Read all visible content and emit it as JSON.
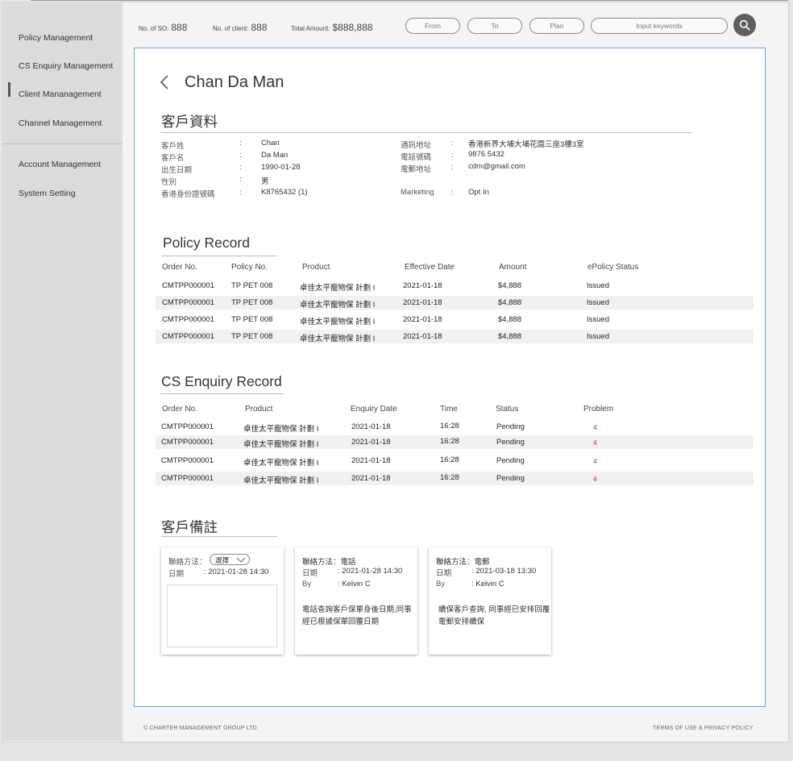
{
  "sidebar": {
    "items": [
      {
        "label": "Policy Management"
      },
      {
        "label": "CS Enquiry Management"
      },
      {
        "label": "Client Mananagement"
      },
      {
        "label": "Channel Management"
      },
      {
        "label": "Account Management"
      },
      {
        "label": "System Setting"
      }
    ],
    "active_index": 2
  },
  "topbar": {
    "so_label": "No. of SO:",
    "so_value": "888",
    "client_label": "No. of client:",
    "client_value": "888",
    "amount_label": "Total Amount:",
    "amount_value": "$888,888",
    "from_placeholder": "From",
    "to_placeholder": "To",
    "plan_placeholder": "Plan",
    "keyword_placeholder": "Input keywords"
  },
  "client": {
    "name": "Chan Da Man",
    "section_title": "客戶資料",
    "fields_left": [
      {
        "label": "客戶姓",
        "value": "Chan"
      },
      {
        "label": "客戶名",
        "value": "Da Man"
      },
      {
        "label": "出生日期",
        "value": "1990-01-28"
      },
      {
        "label": "性別",
        "value": "男"
      },
      {
        "label": "香港身份證號碼",
        "value": "K8765432 (1)"
      }
    ],
    "fields_right": [
      {
        "label": "通訊地址",
        "value": "香港新界大埔大埔花園三座3樓3室"
      },
      {
        "label": "電話號碼",
        "value": "9876 5432"
      },
      {
        "label": "電郵地址",
        "value": "cdm@gmail.com"
      },
      {
        "label": "Marketing",
        "value": "Opt In"
      }
    ],
    "colon": ":"
  },
  "policy": {
    "title": "Policy Record",
    "headers": [
      "Order No.",
      "Policy No.",
      "Product",
      "Effective Date",
      "Amount",
      "ePolicy Status"
    ],
    "rows": [
      [
        "CMTPP000001",
        "TP PET 008",
        "卓佳太平寵物保 計劃 I",
        "2021-01-18",
        "$4,888",
        "Issued"
      ],
      [
        "CMTPP000001",
        "TP PET 008",
        "卓佳太平寵物保 計劃 I",
        "2021-01-18",
        "$4,888",
        "Issued"
      ],
      [
        "CMTPP000001",
        "TP PET 008",
        "卓佳太平寵物保 計劃 I",
        "2021-01-18",
        "$4,888",
        "Issued"
      ],
      [
        "CMTPP000001",
        "TP PET 008",
        "卓佳太平寵物保 計劃 I",
        "2021-01-18",
        "$4,888",
        "Issued"
      ]
    ]
  },
  "enquiry": {
    "title": "CS Enquiry Record",
    "headers": [
      "Order No.",
      "Product",
      "Enquiry Date",
      "Time",
      "Status",
      "Problem"
    ],
    "rows": [
      [
        "CMTPP000001",
        "卓佳太平寵物保 計劃 I",
        "2021-01-18",
        "16:28",
        "Pending",
        "4"
      ],
      [
        "CMTPP000001",
        "卓佳太平寵物保 計劃 I",
        "2021-01-18",
        "16:28",
        "Pending",
        "4"
      ],
      [
        "CMTPP000001",
        "卓佳太平寵物保 計劃 I",
        "2021-01-18",
        "16:28",
        "Pending",
        "4"
      ],
      [
        "CMTPP000001",
        "卓佳太平寵物保 計劃 I",
        "2021-01-18",
        "16:28",
        "Pending",
        "4"
      ]
    ]
  },
  "remarks": {
    "title": "客戶備註",
    "new_card": {
      "contact_label": "聯絡方法：",
      "select_value": "選擇",
      "date_label": "日期",
      "date_value": ": 2021-01-28 14:30"
    },
    "cards": [
      {
        "contact": "聯絡方法：電話",
        "date_label": "日期",
        "date_value": ": 2021-01-28 14:30",
        "by_label": "By",
        "by_value": ":   Kelvin C",
        "note": "電話查詢客戶保單身後日期,同事經已根據保單回覆日期"
      },
      {
        "contact": "聯絡方法：電郵",
        "date_label": "日期",
        "date_value": ": 2021-03-18 13:30",
        "by_label": "By",
        "by_value": ":   Kelvin C",
        "note": "續保客戶查詢, 同事經已安排回覆電郵安排續保"
      }
    ]
  },
  "footer": {
    "copyright": "© CHARTER MANAGEMENT GROUP LTD",
    "terms": "TERMS OF USE & PRIVACY POLICY"
  },
  "colors": {
    "accent_border": "#6aa0e0",
    "problem_red": "#e02020",
    "search_button": "#5f5f5f"
  }
}
